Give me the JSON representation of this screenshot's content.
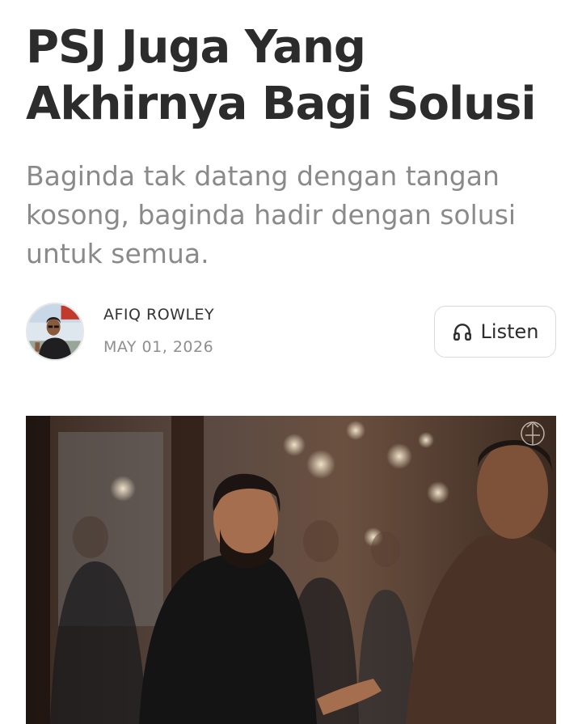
{
  "article": {
    "title": "PSJ Juga Yang Akhirnya Bagi Solusi",
    "subtitle": "Baginda tak datang dengan tangan kosong, baginda hadir dengan solusi untuk semua."
  },
  "byline": {
    "author": "AFIQ ROWLEY",
    "date": "MAY 01, 2026",
    "avatar_icon": "author-avatar"
  },
  "listen_button": {
    "label": "Listen",
    "icon": "headphones-icon"
  },
  "hero_image": {
    "watermark_icon": "royal-crest-watermark",
    "colors": {
      "background": "#2a1d16",
      "shirt_dark": "#141414",
      "shirt_brown": "#4a3226"
    }
  }
}
